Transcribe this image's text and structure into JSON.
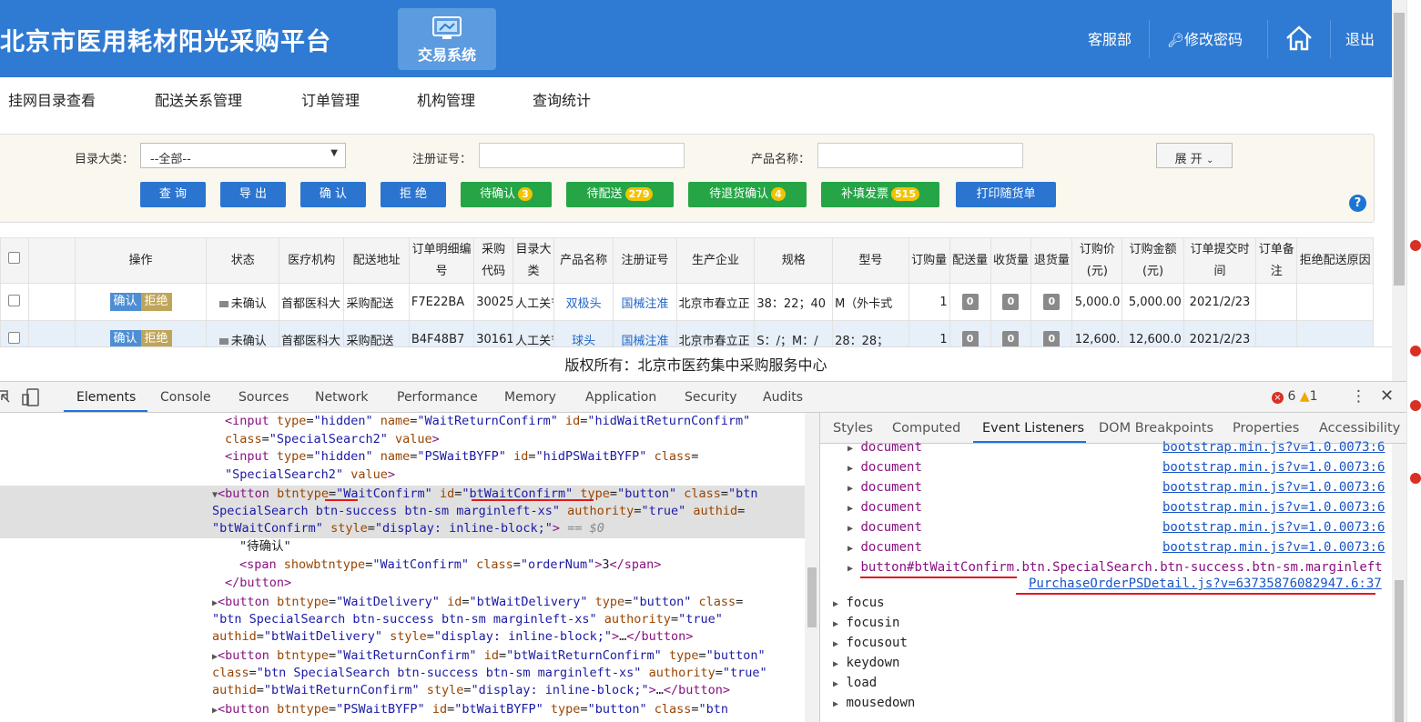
{
  "header": {
    "title": "北京市医用耗材阳光采购平台",
    "system_label": "交易系统",
    "service": "客服部",
    "change_password": "修改密码",
    "logout": "退出"
  },
  "nav": [
    "挂网目录查看",
    "配送关系管理",
    "订单管理",
    "机构管理",
    "查询统计"
  ],
  "filter": {
    "category_label": "目录大类：",
    "category_value": "--全部--",
    "reg_label": "注册证号：",
    "reg_value": "",
    "product_label": "产品名称：",
    "product_value": "",
    "expand": "展 开"
  },
  "buttons": {
    "query": "查 询",
    "export": "导 出",
    "confirm": "确 认",
    "reject": "拒 绝",
    "wait_confirm": "待确认",
    "wait_confirm_n": "3",
    "wait_delivery": "待配送",
    "wait_delivery_n": "279",
    "wait_return": "待退货确认",
    "wait_return_n": "4",
    "invoice": "补填发票",
    "invoice_n": "515",
    "print": "打印随货单"
  },
  "table": {
    "headers": [
      "操作",
      "状态",
      "医疗机构",
      "配送地址",
      "订单明细编号",
      "采购代码",
      "目录大类",
      "产品名称",
      "注册证号",
      "生产企业",
      "规格",
      "型号",
      "订购量",
      "配送量",
      "收货量",
      "退货量",
      "订购价(元)",
      "订购金额(元)",
      "订单提交时间",
      "订单备注",
      "拒绝配送原因"
    ],
    "op_confirm": "确认",
    "op_reject": "拒绝",
    "rows": [
      {
        "status": "未确认",
        "org": "首都医科大",
        "addr": "采购配送",
        "detail": "F7E22BA",
        "code": "30025",
        "cat": "人工关节",
        "name": "双极头",
        "reg": "国械注准",
        "maker": "北京市春立正",
        "spec": "38：22；40",
        "model": "M（外卡式",
        "qty": "1",
        "d": "0",
        "r": "0",
        "ret": "0",
        "price": "5,000.0",
        "amount": "5,000.00",
        "time": "2021/2/23"
      },
      {
        "status": "未确认",
        "org": "首都医科大",
        "addr": "采购配送",
        "detail": "B4F48B7",
        "code": "30161",
        "cat": "人工关节",
        "name": "球头",
        "reg": "国械注准",
        "maker": "北京市春立正",
        "spec": "S：/；M：/",
        "model": "28：28；",
        "qty": "1",
        "d": "0",
        "r": "0",
        "ret": "0",
        "price": "12,600.",
        "amount": "12,600.0",
        "time": "2021/2/23"
      }
    ]
  },
  "copyright": "版权所有：北京市医药集中采购服务中心",
  "devtools": {
    "tabs": [
      "Elements",
      "Console",
      "Sources",
      "Network",
      "Performance",
      "Memory",
      "Application",
      "Security",
      "Audits"
    ],
    "errors": "6",
    "warnings": "1",
    "side_tabs": [
      "Styles",
      "Computed",
      "Event Listeners",
      "DOM Breakpoints",
      "Properties",
      "Accessibility"
    ],
    "listeners": [
      "document",
      "document",
      "document",
      "document",
      "document",
      "document"
    ],
    "listener_src": "bootstrap.min.js?v=1.0.0073:6",
    "button_selector": "button#btWaitConfirm.btn.SpecialSearch.btn-success.btn-sm.marginleft",
    "button_src": "PurchaseOrderPSDetail.js?v=63735876082947.6:37",
    "events": [
      "focus",
      "focusin",
      "focusout",
      "keydown",
      "load",
      "mousedown"
    ],
    "code_text": "\"待确认\""
  }
}
